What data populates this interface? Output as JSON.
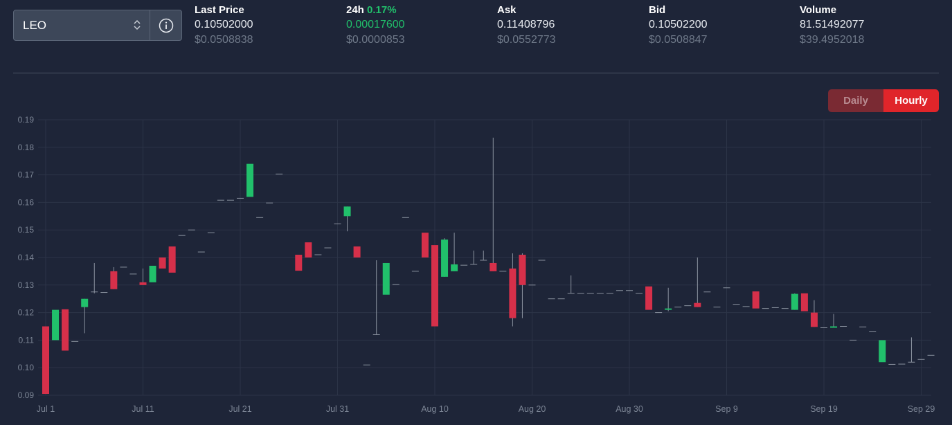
{
  "market": {
    "selected": "LEO",
    "info_icon": "info-circle-icon",
    "select_icon": "chevron-up-down-icon"
  },
  "stats": [
    {
      "label": "Last Price",
      "pct": "",
      "value": "0.10502000",
      "usd": "$0.0508838",
      "value_color": "default"
    },
    {
      "label": "24h",
      "pct": "0.17%",
      "value": "0.00017600",
      "usd": "$0.0000853",
      "value_color": "green"
    },
    {
      "label": "Ask",
      "pct": "",
      "value": "0.11408796",
      "usd": "$0.0552773",
      "value_color": "default"
    },
    {
      "label": "Bid",
      "pct": "",
      "value": "0.10502200",
      "usd": "$0.0508847",
      "value_color": "default"
    },
    {
      "label": "Volume",
      "pct": "",
      "value": "81.51492077",
      "usd": "$39.4952018",
      "value_color": "default"
    }
  ],
  "period_toggle": {
    "daily": "Daily",
    "hourly": "Hourly",
    "active": "Hourly"
  },
  "colors": {
    "up": "#21c06b",
    "down": "#d6304a",
    "accent": "#e0252a",
    "flat": "#8a929f"
  },
  "chart_data": {
    "type": "candlestick",
    "ylim": [
      0.09,
      0.19
    ],
    "yticks": [
      "0.19",
      "0.18",
      "0.17",
      "0.16",
      "0.15",
      "0.14",
      "0.13",
      "0.12",
      "0.11",
      "0.10",
      "0.09"
    ],
    "xticks": [
      "Jul 1",
      "Jul 11",
      "Jul 21",
      "Jul 31",
      "Aug 10",
      "Aug 20",
      "Aug 30",
      "Sep 9",
      "Sep 19",
      "Sep 29"
    ],
    "grid": true,
    "candles": [
      {
        "date": "Jul 1",
        "o": 0.115,
        "h": 0.115,
        "l": 0.0905,
        "c": 0.0905
      },
      {
        "date": "Jul 2",
        "o": 0.11,
        "h": 0.121,
        "l": 0.11,
        "c": 0.121
      },
      {
        "date": "Jul 3",
        "o": 0.1212,
        "h": 0.1212,
        "l": 0.1062,
        "c": 0.1062
      },
      {
        "date": "Jul 4",
        "o": 0.1095,
        "h": 0.1095,
        "l": 0.1095,
        "c": 0.1095
      },
      {
        "date": "Jul 5",
        "o": 0.122,
        "h": 0.125,
        "l": 0.1125,
        "c": 0.125
      },
      {
        "date": "Jul 6",
        "o": 0.1275,
        "h": 0.138,
        "l": 0.127,
        "c": 0.1275
      },
      {
        "date": "Jul 7",
        "o": 0.1273,
        "h": 0.1273,
        "l": 0.1273,
        "c": 0.1273
      },
      {
        "date": "Jul 8",
        "o": 0.135,
        "h": 0.1365,
        "l": 0.1285,
        "c": 0.1285
      },
      {
        "date": "Jul 9",
        "o": 0.1365,
        "h": 0.1365,
        "l": 0.1365,
        "c": 0.1365
      },
      {
        "date": "Jul 10",
        "o": 0.134,
        "h": 0.134,
        "l": 0.134,
        "c": 0.134
      },
      {
        "date": "Jul 11",
        "o": 0.131,
        "h": 0.136,
        "l": 0.13,
        "c": 0.13
      },
      {
        "date": "Jul 12",
        "o": 0.131,
        "h": 0.137,
        "l": 0.131,
        "c": 0.137
      },
      {
        "date": "Jul 13",
        "o": 0.14,
        "h": 0.14,
        "l": 0.136,
        "c": 0.136
      },
      {
        "date": "Jul 14",
        "o": 0.144,
        "h": 0.144,
        "l": 0.1345,
        "c": 0.1345
      },
      {
        "date": "Jul 15",
        "o": 0.148,
        "h": 0.148,
        "l": 0.148,
        "c": 0.148
      },
      {
        "date": "Jul 16",
        "o": 0.15,
        "h": 0.15,
        "l": 0.15,
        "c": 0.15
      },
      {
        "date": "Jul 17",
        "o": 0.142,
        "h": 0.142,
        "l": 0.142,
        "c": 0.142
      },
      {
        "date": "Jul 18",
        "o": 0.149,
        "h": 0.149,
        "l": 0.149,
        "c": 0.149
      },
      {
        "date": "Jul 19",
        "o": 0.1608,
        "h": 0.1608,
        "l": 0.1608,
        "c": 0.1608
      },
      {
        "date": "Jul 20",
        "o": 0.1608,
        "h": 0.1608,
        "l": 0.1608,
        "c": 0.1608
      },
      {
        "date": "Jul 21",
        "o": 0.1615,
        "h": 0.1615,
        "l": 0.1615,
        "c": 0.1615
      },
      {
        "date": "Jul 22",
        "o": 0.162,
        "h": 0.174,
        "l": 0.162,
        "c": 0.174
      },
      {
        "date": "Jul 23",
        "o": 0.1545,
        "h": 0.1545,
        "l": 0.1545,
        "c": 0.1545
      },
      {
        "date": "Jul 24",
        "o": 0.1598,
        "h": 0.1598,
        "l": 0.1598,
        "c": 0.1598
      },
      {
        "date": "Jul 25",
        "o": 0.1703,
        "h": 0.1703,
        "l": 0.1703,
        "c": 0.1703
      },
      {
        "date": "Jul 27",
        "o": 0.141,
        "h": 0.141,
        "l": 0.1352,
        "c": 0.1352
      },
      {
        "date": "Jul 28",
        "o": 0.1455,
        "h": 0.1455,
        "l": 0.14,
        "c": 0.14
      },
      {
        "date": "Jul 29",
        "o": 0.141,
        "h": 0.141,
        "l": 0.141,
        "c": 0.141
      },
      {
        "date": "Jul 30",
        "o": 0.1435,
        "h": 0.1435,
        "l": 0.1435,
        "c": 0.1435
      },
      {
        "date": "Jul 31",
        "o": 0.1522,
        "h": 0.1522,
        "l": 0.1522,
        "c": 0.1522
      },
      {
        "date": "Aug 1",
        "o": 0.155,
        "h": 0.1585,
        "l": 0.1495,
        "c": 0.1585
      },
      {
        "date": "Aug 2",
        "o": 0.144,
        "h": 0.144,
        "l": 0.14,
        "c": 0.14
      },
      {
        "date": "Aug 3",
        "o": 0.101,
        "h": 0.101,
        "l": 0.101,
        "c": 0.101
      },
      {
        "date": "Aug 4",
        "o": 0.112,
        "h": 0.139,
        "l": 0.112,
        "c": 0.112
      },
      {
        "date": "Aug 5",
        "o": 0.1265,
        "h": 0.138,
        "l": 0.1265,
        "c": 0.138
      },
      {
        "date": "Aug 6",
        "o": 0.1302,
        "h": 0.1302,
        "l": 0.1302,
        "c": 0.1302
      },
      {
        "date": "Aug 7",
        "o": 0.1545,
        "h": 0.1545,
        "l": 0.1545,
        "c": 0.1545
      },
      {
        "date": "Aug 8",
        "o": 0.135,
        "h": 0.135,
        "l": 0.135,
        "c": 0.135
      },
      {
        "date": "Aug 9",
        "o": 0.149,
        "h": 0.149,
        "l": 0.14,
        "c": 0.14
      },
      {
        "date": "Aug 10",
        "o": 0.1445,
        "h": 0.1445,
        "l": 0.115,
        "c": 0.115
      },
      {
        "date": "Aug 11",
        "o": 0.133,
        "h": 0.147,
        "l": 0.133,
        "c": 0.1465
      },
      {
        "date": "Aug 12",
        "o": 0.135,
        "h": 0.149,
        "l": 0.135,
        "c": 0.1375
      },
      {
        "date": "Aug 13",
        "o": 0.1372,
        "h": 0.1372,
        "l": 0.1372,
        "c": 0.1372
      },
      {
        "date": "Aug 14",
        "o": 0.1375,
        "h": 0.1425,
        "l": 0.1375,
        "c": 0.1375
      },
      {
        "date": "Aug 15",
        "o": 0.139,
        "h": 0.1425,
        "l": 0.139,
        "c": 0.139
      },
      {
        "date": "Aug 16",
        "o": 0.138,
        "h": 0.1835,
        "l": 0.135,
        "c": 0.135
      },
      {
        "date": "Aug 17",
        "o": 0.135,
        "h": 0.135,
        "l": 0.135,
        "c": 0.135
      },
      {
        "date": "Aug 18",
        "o": 0.136,
        "h": 0.1415,
        "l": 0.115,
        "c": 0.118
      },
      {
        "date": "Aug 19",
        "o": 0.141,
        "h": 0.1415,
        "l": 0.118,
        "c": 0.13
      },
      {
        "date": "Aug 20",
        "o": 0.13,
        "h": 0.13,
        "l": 0.13,
        "c": 0.13
      },
      {
        "date": "Aug 21",
        "o": 0.139,
        "h": 0.139,
        "l": 0.139,
        "c": 0.139
      },
      {
        "date": "Aug 22",
        "o": 0.125,
        "h": 0.125,
        "l": 0.125,
        "c": 0.125
      },
      {
        "date": "Aug 23",
        "o": 0.125,
        "h": 0.125,
        "l": 0.125,
        "c": 0.125
      },
      {
        "date": "Aug 24",
        "o": 0.127,
        "h": 0.1335,
        "l": 0.127,
        "c": 0.127
      },
      {
        "date": "Aug 25",
        "o": 0.127,
        "h": 0.127,
        "l": 0.127,
        "c": 0.127
      },
      {
        "date": "Aug 26",
        "o": 0.127,
        "h": 0.127,
        "l": 0.127,
        "c": 0.127
      },
      {
        "date": "Aug 27",
        "o": 0.127,
        "h": 0.127,
        "l": 0.127,
        "c": 0.127
      },
      {
        "date": "Aug 28",
        "o": 0.127,
        "h": 0.127,
        "l": 0.127,
        "c": 0.127
      },
      {
        "date": "Aug 29",
        "o": 0.128,
        "h": 0.128,
        "l": 0.128,
        "c": 0.128
      },
      {
        "date": "Aug 30",
        "o": 0.128,
        "h": 0.128,
        "l": 0.128,
        "c": 0.128
      },
      {
        "date": "Aug 31",
        "o": 0.127,
        "h": 0.127,
        "l": 0.127,
        "c": 0.127
      },
      {
        "date": "Sep 1",
        "o": 0.1295,
        "h": 0.1295,
        "l": 0.121,
        "c": 0.121
      },
      {
        "date": "Sep 2",
        "o": 0.12,
        "h": 0.12,
        "l": 0.12,
        "c": 0.12
      },
      {
        "date": "Sep 3",
        "o": 0.121,
        "h": 0.129,
        "l": 0.1205,
        "c": 0.1215
      },
      {
        "date": "Sep 4",
        "o": 0.122,
        "h": 0.122,
        "l": 0.122,
        "c": 0.122
      },
      {
        "date": "Sep 5",
        "o": 0.1225,
        "h": 0.1225,
        "l": 0.1225,
        "c": 0.1225
      },
      {
        "date": "Sep 6",
        "o": 0.1235,
        "h": 0.14,
        "l": 0.122,
        "c": 0.122
      },
      {
        "date": "Sep 7",
        "o": 0.1275,
        "h": 0.1275,
        "l": 0.1275,
        "c": 0.1275
      },
      {
        "date": "Sep 8",
        "o": 0.122,
        "h": 0.122,
        "l": 0.122,
        "c": 0.122
      },
      {
        "date": "Sep 9",
        "o": 0.129,
        "h": 0.129,
        "l": 0.129,
        "c": 0.129
      },
      {
        "date": "Sep 10",
        "o": 0.123,
        "h": 0.123,
        "l": 0.123,
        "c": 0.123
      },
      {
        "date": "Sep 11",
        "o": 0.1222,
        "h": 0.1222,
        "l": 0.1222,
        "c": 0.1222
      },
      {
        "date": "Sep 12",
        "o": 0.1277,
        "h": 0.1277,
        "l": 0.1215,
        "c": 0.1215
      },
      {
        "date": "Sep 13",
        "o": 0.1215,
        "h": 0.1215,
        "l": 0.1215,
        "c": 0.1215
      },
      {
        "date": "Sep 14",
        "o": 0.1218,
        "h": 0.1218,
        "l": 0.1218,
        "c": 0.1218
      },
      {
        "date": "Sep 15",
        "o": 0.1215,
        "h": 0.1215,
        "l": 0.1215,
        "c": 0.1215
      },
      {
        "date": "Sep 16",
        "o": 0.121,
        "h": 0.127,
        "l": 0.121,
        "c": 0.1268
      },
      {
        "date": "Sep 17",
        "o": 0.127,
        "h": 0.127,
        "l": 0.1205,
        "c": 0.1205
      },
      {
        "date": "Sep 18",
        "o": 0.12,
        "h": 0.1245,
        "l": 0.1148,
        "c": 0.1148
      },
      {
        "date": "Sep 19",
        "o": 0.1145,
        "h": 0.1145,
        "l": 0.1145,
        "c": 0.1145
      },
      {
        "date": "Sep 20",
        "o": 0.1145,
        "h": 0.1195,
        "l": 0.1145,
        "c": 0.115
      },
      {
        "date": "Sep 21",
        "o": 0.115,
        "h": 0.115,
        "l": 0.115,
        "c": 0.115
      },
      {
        "date": "Sep 22",
        "o": 0.11,
        "h": 0.11,
        "l": 0.11,
        "c": 0.11
      },
      {
        "date": "Sep 23",
        "o": 0.1148,
        "h": 0.1148,
        "l": 0.1148,
        "c": 0.1148
      },
      {
        "date": "Sep 24",
        "o": 0.1132,
        "h": 0.1132,
        "l": 0.1132,
        "c": 0.1132
      },
      {
        "date": "Sep 25",
        "o": 0.102,
        "h": 0.11,
        "l": 0.102,
        "c": 0.11
      },
      {
        "date": "Sep 26",
        "o": 0.1012,
        "h": 0.1012,
        "l": 0.1012,
        "c": 0.1012
      },
      {
        "date": "Sep 27",
        "o": 0.1013,
        "h": 0.1013,
        "l": 0.1013,
        "c": 0.1013
      },
      {
        "date": "Sep 28",
        "o": 0.102,
        "h": 0.111,
        "l": 0.102,
        "c": 0.102
      },
      {
        "date": "Sep 29",
        "o": 0.103,
        "h": 0.103,
        "l": 0.103,
        "c": 0.103
      },
      {
        "date": "Sep 30",
        "o": 0.1045,
        "h": 0.1045,
        "l": 0.1045,
        "c": 0.1045
      }
    ]
  }
}
